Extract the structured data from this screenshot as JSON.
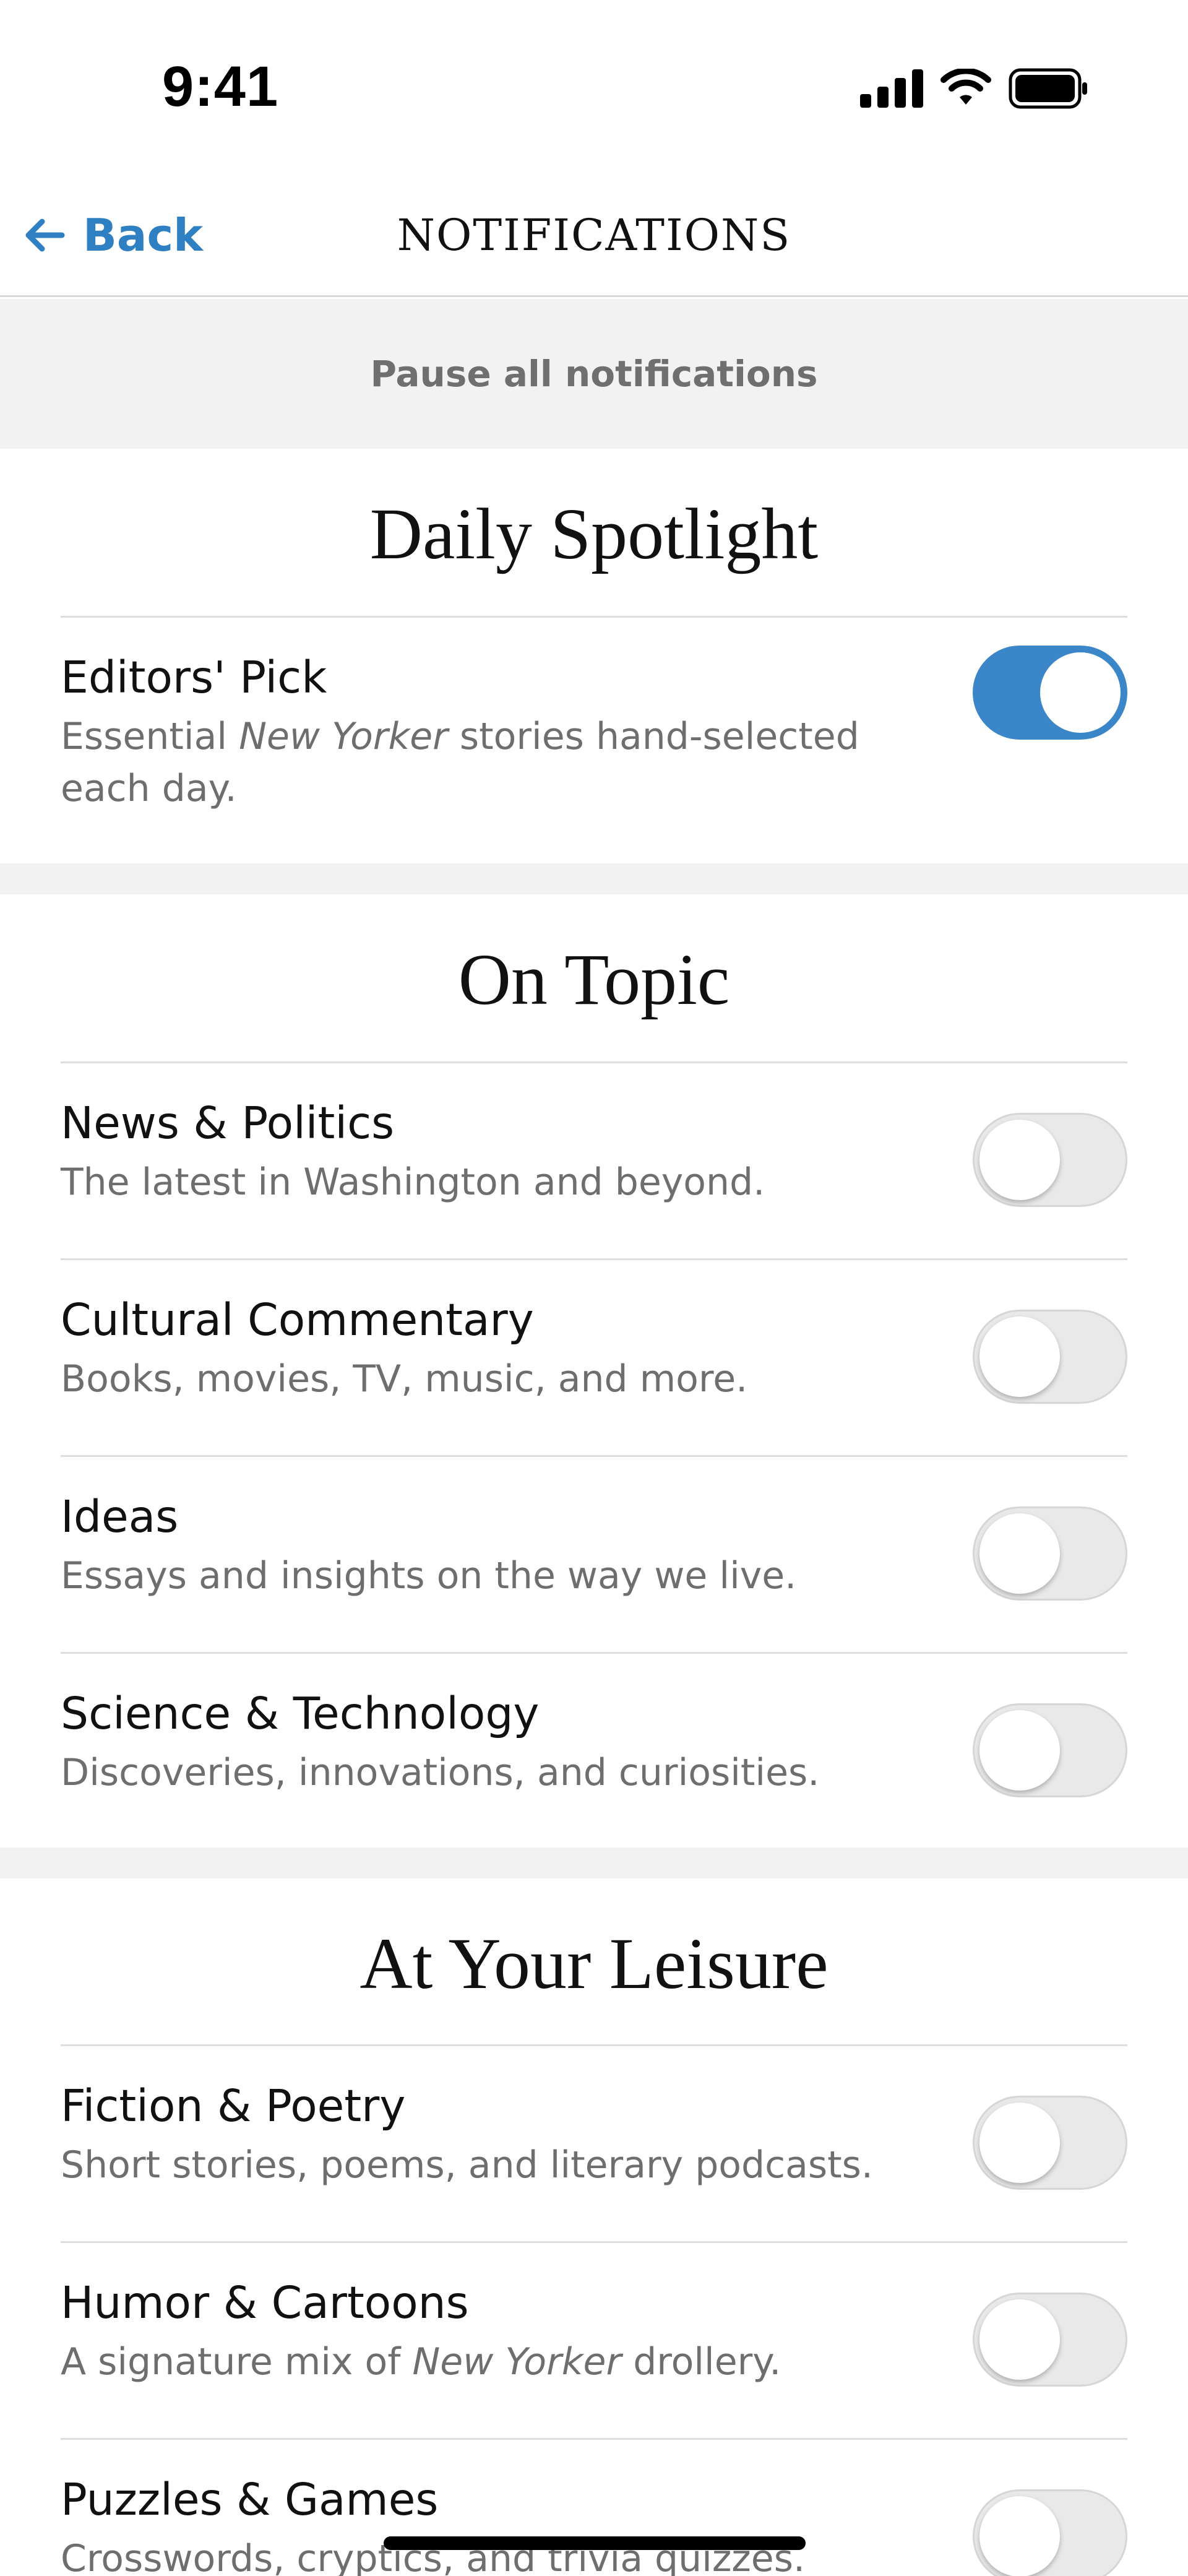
{
  "status_bar": {
    "time": "9:41"
  },
  "nav": {
    "back_label": "Back",
    "title": "NOTIFICATIONS"
  },
  "pause": {
    "label": "Pause all notifications"
  },
  "sections": [
    {
      "title": "Daily Spotlight",
      "items": [
        {
          "title": "Editors' Pick",
          "desc_pre": "Essential ",
          "desc_em": "New Yorker",
          "desc_post": " stories hand-selected each day.",
          "enabled": true
        }
      ]
    },
    {
      "title": "On Topic",
      "items": [
        {
          "title": "News & Politics",
          "desc": "The latest in Washington and beyond.",
          "enabled": false
        },
        {
          "title": "Cultural Commentary",
          "desc": "Books, movies, TV, music, and more.",
          "enabled": false
        },
        {
          "title": "Ideas",
          "desc": "Essays and insights on the way we live.",
          "enabled": false
        },
        {
          "title": "Science & Technology",
          "desc": "Discoveries, innovations, and curiosities.",
          "enabled": false
        }
      ]
    },
    {
      "title": "At Your Leisure",
      "items": [
        {
          "title": "Fiction & Poetry",
          "desc": "Short stories, poems, and literary podcasts.",
          "enabled": false
        },
        {
          "title": "Humor & Cartoons",
          "desc_pre": "A signature mix of ",
          "desc_em": "New Yorker",
          "desc_post": " drollery.",
          "enabled": false
        },
        {
          "title": "Puzzles & Games",
          "desc": "Crosswords, cryptics, and trivia quizzes.",
          "enabled": false
        }
      ]
    }
  ],
  "colors": {
    "accent": "#3b86c9",
    "back_link": "#2f7fc3",
    "toggle_off": "#e9e9e9",
    "section_gap": "#f2f2f2"
  }
}
